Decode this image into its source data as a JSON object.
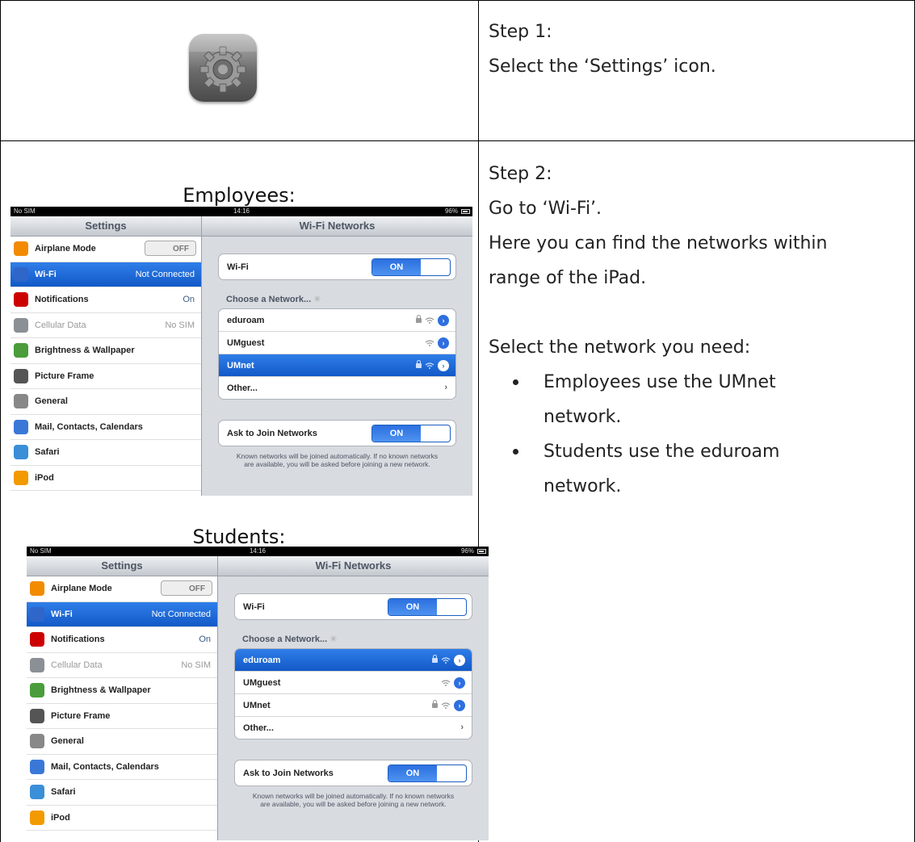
{
  "step1": {
    "title": "Step 1:",
    "text": "Select the ‘Settings’ icon."
  },
  "step2": {
    "title": "Step 2:",
    "line1": "Go to ‘Wi-Fi’.",
    "line2": "Here you can find the networks within",
    "line3": "range of the iPad.",
    "line4": "Select the network you need:",
    "bullet1_a": "Employees use the UMnet",
    "bullet1_b": "network.",
    "bullet2_a": "Students use the eduroam",
    "bullet2_b": "network."
  },
  "captions": {
    "employees": "Employees:",
    "students": "Students:"
  },
  "ipad": {
    "status": {
      "carrier": "No SIM",
      "time": "14:16",
      "battery": "96%"
    },
    "left_title": "Settings",
    "right_title": "Wi-Fi Networks",
    "left_items": [
      {
        "label": "Airplane Mode",
        "value": "OFF"
      },
      {
        "label": "Wi-Fi",
        "value": "Not Connected"
      },
      {
        "label": "Notifications",
        "value": "On"
      },
      {
        "label": "Cellular Data",
        "value": "No SIM"
      },
      {
        "label": "Brightness & Wallpaper",
        "value": ""
      },
      {
        "label": "Picture Frame",
        "value": ""
      },
      {
        "label": "General",
        "value": ""
      },
      {
        "label": "Mail, Contacts, Calendars",
        "value": ""
      },
      {
        "label": "Safari",
        "value": ""
      },
      {
        "label": "iPod",
        "value": ""
      }
    ],
    "wifi_label": "Wi-Fi",
    "on_label": "ON",
    "choose_label": "Choose a Network...",
    "networks": [
      "eduroam",
      "UMguest",
      "UMnet",
      "Other..."
    ],
    "ask_label": "Ask to Join Networks",
    "note": "Known networks will be joined automatically.  If no known networks are available, you will be asked before joining a new network."
  },
  "colors": {
    "selection": "#1a66d8",
    "icon_bg": "#6a6a6a"
  }
}
